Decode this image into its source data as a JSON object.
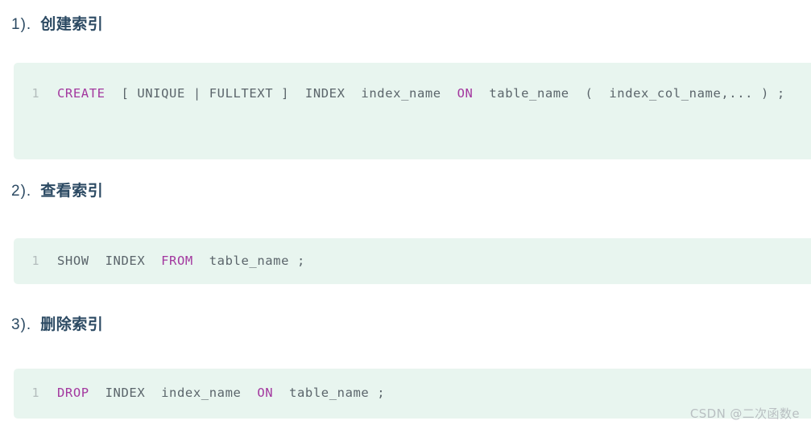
{
  "sections": [
    {
      "number": "1).",
      "title": "创建索引",
      "code": {
        "line_number": "1",
        "tokens": [
          {
            "text": "CREATE",
            "type": "keyword"
          },
          {
            "text": "  [ UNIQUE | FULLTEXT ]  ",
            "type": "plain"
          },
          {
            "text": "INDEX",
            "type": "plain"
          },
          {
            "text": "  index_name  ",
            "type": "plain"
          },
          {
            "text": "ON",
            "type": "keyword"
          },
          {
            "text": "  table_name  (  index_col_name,... ) ;",
            "type": "plain"
          }
        ],
        "plain_text": "CREATE  [ UNIQUE | FULLTEXT ]  INDEX  index_name  ON  table_name  ( index_col_name,... ) ;"
      }
    },
    {
      "number": "2).",
      "title": "查看索引",
      "code": {
        "line_number": "1",
        "tokens": [
          {
            "text": "SHOW  INDEX  ",
            "type": "plain"
          },
          {
            "text": "FROM",
            "type": "keyword"
          },
          {
            "text": "  table_name ;",
            "type": "plain"
          }
        ],
        "plain_text": "SHOW  INDEX  FROM  table_name ;"
      }
    },
    {
      "number": "3).",
      "title": "删除索引",
      "code": {
        "line_number": "1",
        "tokens": [
          {
            "text": "DROP",
            "type": "keyword"
          },
          {
            "text": "  INDEX  index_name  ",
            "type": "plain"
          },
          {
            "text": "ON",
            "type": "keyword"
          },
          {
            "text": "  table_name ;",
            "type": "plain"
          }
        ],
        "plain_text": "DROP  INDEX  index_name  ON  table_name ;"
      }
    }
  ],
  "watermark": {
    "text": "CSDN @二次函数e"
  },
  "colors": {
    "page_background": "#ffffff",
    "code_background": "#e8f5ef",
    "heading": "#2c4a63",
    "code_text": "#5b656b",
    "keyword": "#a3389f",
    "line_number": "#b3bcbc",
    "watermark": "#b9bfc2"
  }
}
